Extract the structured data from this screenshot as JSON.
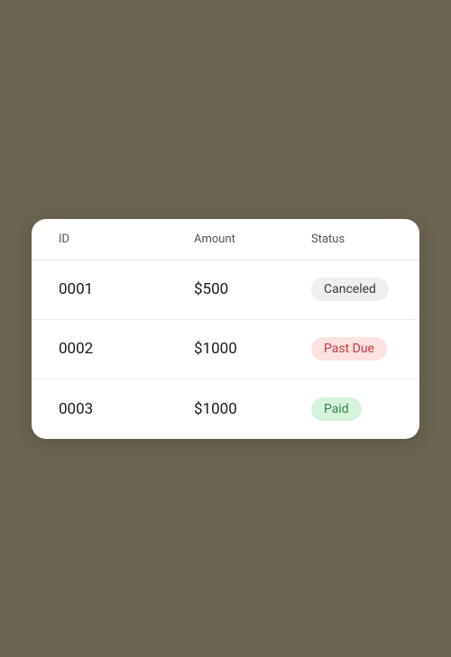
{
  "table": {
    "headers": {
      "id": "ID",
      "amount": "Amount",
      "status": "Status"
    },
    "rows": [
      {
        "id": "0001",
        "amount": "$500",
        "status": "Canceled",
        "status_kind": "canceled"
      },
      {
        "id": "0002",
        "amount": "$1000",
        "status": "Past Due",
        "status_kind": "pastdue"
      },
      {
        "id": "0003",
        "amount": "$1000",
        "status": "Paid",
        "status_kind": "paid"
      }
    ]
  }
}
